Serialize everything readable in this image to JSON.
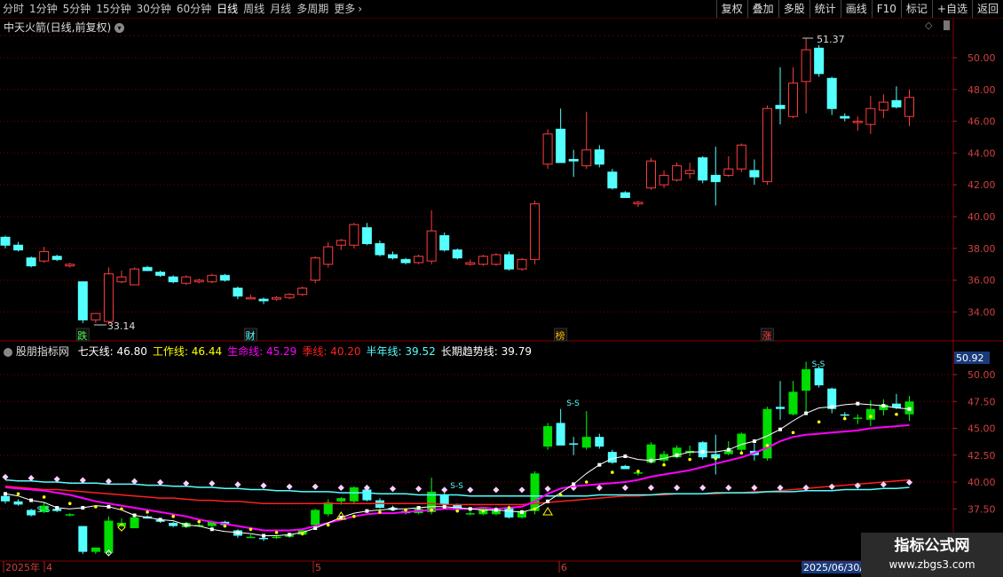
{
  "toolbar": {
    "periods": [
      "分时",
      "1分钟",
      "5分钟",
      "15分钟",
      "30分钟",
      "60分钟",
      "日线",
      "周线",
      "月线",
      "多周期",
      "更多"
    ],
    "active_period": "日线",
    "right_buttons": [
      "复权",
      "叠加",
      "多股",
      "统计",
      "画线",
      "F10",
      "标记",
      "+自选",
      "返回"
    ]
  },
  "colors": {
    "up": "#ff3c3c",
    "down": "#54ffff",
    "bg": "#000000",
    "grid": "#7a0000",
    "seven": "#ffffff",
    "work": "#ffff00",
    "life": "#ff00ff",
    "season": "#ff2020",
    "half": "#54ffff",
    "long": "#ffd0ff"
  },
  "main_panel": {
    "title": "中天火箭(日线,前复权)",
    "y_ticks": [
      "50.00",
      "48.00",
      "46.00",
      "44.00",
      "42.00",
      "40.00",
      "38.00",
      "36.00",
      "34.00"
    ],
    "high_label": "51.37",
    "low_label": "33.14",
    "event_tags": [
      "跌",
      "财",
      "榜",
      "涨"
    ]
  },
  "indicator_panel": {
    "title": "股朋指标网",
    "lines": [
      {
        "name": "七天线",
        "value": "46.80"
      },
      {
        "name": "工作线",
        "value": "46.44"
      },
      {
        "name": "生命线",
        "value": "45.29"
      },
      {
        "name": "季线",
        "value": "40.20"
      },
      {
        "name": "半年线",
        "value": "39.52"
      },
      {
        "name": "长期趋势线",
        "value": "39.79"
      }
    ],
    "current_value": "50.92",
    "y_ticks": [
      "50.00",
      "47.50",
      "45.00",
      "42.50",
      "40.00",
      "37.50"
    ],
    "signal_label": "S-S"
  },
  "x_axis": {
    "labels": [
      "2025年",
      "4",
      "5",
      "6"
    ],
    "cursor_date": "2025/06/30/"
  },
  "chart_data": {
    "type": "candlestick",
    "ylim": [
      33,
      52
    ],
    "ohlc": [
      [
        38.7,
        38.8,
        38.0,
        38.2
      ],
      [
        38.2,
        38.4,
        37.8,
        37.9
      ],
      [
        37.4,
        37.5,
        36.8,
        36.9
      ],
      [
        37.2,
        38.1,
        37.1,
        37.8
      ],
      [
        37.5,
        37.6,
        37.2,
        37.3
      ],
      [
        36.9,
        37.1,
        36.8,
        37.0
      ],
      [
        35.9,
        35.9,
        33.3,
        33.5
      ],
      [
        33.5,
        33.9,
        33.3,
        33.9
      ],
      [
        33.4,
        36.8,
        33.2,
        36.4
      ],
      [
        35.9,
        36.6,
        35.8,
        36.2
      ],
      [
        35.7,
        36.8,
        35.7,
        36.7
      ],
      [
        36.8,
        36.9,
        36.6,
        36.6
      ],
      [
        36.5,
        36.6,
        36.2,
        36.3
      ],
      [
        36.2,
        36.3,
        35.8,
        35.9
      ],
      [
        35.8,
        36.3,
        35.7,
        36.2
      ],
      [
        35.9,
        36.1,
        35.8,
        36.0
      ],
      [
        35.9,
        36.4,
        35.8,
        36.3
      ],
      [
        36.3,
        36.4,
        35.9,
        36.0
      ],
      [
        35.5,
        35.6,
        34.8,
        35.0
      ],
      [
        34.9,
        35.1,
        34.8,
        34.9
      ],
      [
        34.8,
        34.9,
        34.5,
        34.7
      ],
      [
        34.8,
        35.0,
        34.7,
        34.9
      ],
      [
        34.9,
        35.2,
        34.8,
        35.1
      ],
      [
        35.1,
        35.6,
        35.0,
        35.5
      ],
      [
        36.0,
        37.5,
        35.8,
        37.4
      ],
      [
        37.0,
        38.4,
        36.8,
        38.1
      ],
      [
        38.2,
        38.6,
        37.9,
        38.5
      ],
      [
        38.2,
        39.6,
        38.0,
        39.5
      ],
      [
        39.3,
        39.6,
        38.2,
        38.3
      ],
      [
        38.3,
        38.5,
        37.5,
        37.6
      ],
      [
        37.6,
        37.8,
        37.3,
        37.4
      ],
      [
        37.3,
        37.4,
        37.0,
        37.1
      ],
      [
        37.1,
        37.6,
        37.0,
        37.5
      ],
      [
        37.2,
        40.4,
        37.0,
        39.1
      ],
      [
        38.8,
        39.0,
        37.8,
        37.9
      ],
      [
        37.9,
        38.0,
        37.3,
        37.4
      ],
      [
        37.0,
        37.3,
        36.9,
        37.1
      ],
      [
        37.0,
        37.6,
        36.9,
        37.5
      ],
      [
        37.0,
        37.7,
        36.9,
        37.6
      ],
      [
        37.6,
        37.8,
        36.6,
        36.7
      ],
      [
        36.7,
        37.4,
        36.6,
        37.3
      ],
      [
        37.3,
        41.0,
        37.0,
        40.8
      ],
      [
        43.3,
        45.5,
        43.0,
        45.2
      ],
      [
        45.5,
        46.8,
        44.0,
        43.4
      ],
      [
        43.6,
        44.2,
        42.5,
        43.5
      ],
      [
        43.2,
        46.6,
        43.0,
        44.2
      ],
      [
        44.2,
        44.5,
        43.1,
        43.3
      ],
      [
        42.8,
        43.0,
        41.7,
        41.8
      ],
      [
        41.5,
        41.6,
        41.2,
        41.2
      ],
      [
        40.8,
        41.0,
        40.6,
        40.9
      ],
      [
        41.8,
        43.7,
        41.7,
        43.5
      ],
      [
        42.0,
        42.9,
        41.8,
        42.6
      ],
      [
        42.3,
        43.4,
        42.2,
        43.2
      ],
      [
        42.7,
        43.4,
        42.4,
        42.9
      ],
      [
        43.7,
        43.8,
        42.1,
        42.3
      ],
      [
        42.6,
        44.4,
        40.7,
        42.2
      ],
      [
        42.6,
        43.8,
        42.5,
        43.0
      ],
      [
        43.0,
        44.6,
        42.8,
        44.5
      ],
      [
        42.9,
        43.6,
        42.0,
        42.5
      ],
      [
        42.2,
        47.0,
        42.0,
        46.8
      ],
      [
        47.0,
        49.4,
        45.8,
        46.8
      ],
      [
        46.3,
        49.4,
        46.2,
        48.4
      ],
      [
        48.5,
        51.2,
        46.5,
        50.5
      ],
      [
        50.6,
        50.8,
        48.8,
        49.0
      ],
      [
        48.7,
        48.8,
        46.4,
        46.8
      ],
      [
        46.3,
        46.5,
        46.0,
        46.2
      ],
      [
        46.0,
        46.3,
        45.4,
        46.0
      ],
      [
        45.8,
        47.6,
        45.2,
        46.8
      ],
      [
        46.7,
        47.7,
        46.2,
        47.2
      ],
      [
        47.3,
        48.2,
        46.8,
        46.9
      ],
      [
        46.3,
        48.0,
        45.7,
        47.5
      ]
    ],
    "series": [
      {
        "name": "七天线",
        "values": [
          38.9,
          38.7,
          38.3,
          38.1,
          37.6,
          37.5,
          37.6,
          37.8,
          37.7,
          37.4,
          36.9,
          36.7,
          36.5,
          36.4,
          36.0,
          35.9,
          35.6,
          35.4,
          35.3,
          35.2,
          35.0,
          35.0,
          35.1,
          35.3,
          35.7,
          36.2,
          36.7,
          37.1,
          37.3,
          37.4,
          37.5,
          37.5,
          37.6,
          37.7,
          37.7,
          37.6,
          37.5,
          37.4,
          37.4,
          37.3,
          37.2,
          37.5,
          38.2,
          39.0,
          39.8,
          40.8,
          41.6,
          42.2,
          42.4,
          42.1,
          42.0,
          42.2,
          42.5,
          42.8,
          42.8,
          42.8,
          43.0,
          43.5,
          43.8,
          44.3,
          44.9,
          45.7,
          46.4,
          46.9,
          47.0,
          47.2,
          47.3,
          47.2,
          47.1,
          46.9,
          46.8
        ]
      },
      {
        "name": "工作线",
        "values": [
          39.3,
          38.9,
          38.7,
          38.6,
          38.4,
          38.0,
          37.9,
          37.7,
          37.5,
          37.5,
          37.5,
          37.2,
          37.0,
          36.8,
          36.5,
          36.3,
          36.1,
          35.9,
          35.8,
          35.6,
          35.4,
          35.3,
          35.1,
          35.2,
          35.6,
          36.0,
          36.4,
          36.8,
          37.0,
          37.2,
          37.3,
          37.4,
          37.3,
          37.4,
          37.4,
          37.3,
          37.2,
          37.3,
          37.4,
          37.6,
          37.5,
          37.5,
          38.2,
          38.8,
          39.5,
          40.0,
          40.5,
          40.9,
          41.2,
          41.0,
          41.4,
          41.6,
          41.8,
          42.1,
          42.3,
          42.2,
          42.5,
          42.7,
          43.0,
          43.4,
          44.0,
          44.6,
          45.2,
          45.6,
          45.8,
          45.9,
          45.9,
          46.1,
          46.2,
          46.3,
          46.4
        ]
      },
      {
        "name": "生命线",
        "values": [
          39.5,
          39.4,
          39.3,
          39.2,
          39.0,
          38.8,
          38.5,
          38.2,
          38.0,
          37.8,
          37.6,
          37.4,
          37.2,
          37.0,
          36.8,
          36.5,
          36.3,
          36.1,
          35.9,
          35.7,
          35.5,
          35.5,
          35.5,
          35.6,
          35.9,
          36.2,
          36.5,
          36.8,
          37.0,
          37.1,
          37.1,
          37.2,
          37.3,
          37.4,
          37.5,
          37.5,
          37.5,
          37.6,
          37.5,
          37.6,
          37.7,
          38.2,
          38.9,
          39.4,
          39.6,
          39.7,
          39.8,
          39.9,
          40.0,
          40.2,
          40.5,
          40.7,
          40.9,
          41.1,
          41.4,
          41.7,
          42.0,
          42.3,
          42.7,
          43.2,
          43.8,
          44.2,
          44.4,
          44.5,
          44.6,
          44.7,
          44.8,
          45.0,
          45.1,
          45.2,
          45.3
        ]
      },
      {
        "name": "季线",
        "values": [
          39.6,
          39.5,
          39.4,
          39.3,
          39.3,
          39.2,
          39.1,
          39.0,
          38.9,
          38.8,
          38.7,
          38.6,
          38.5,
          38.5,
          38.4,
          38.3,
          38.3,
          38.2,
          38.2,
          38.1,
          38.0,
          38.0,
          38.0,
          38.0,
          38.0,
          38.0,
          38.0,
          38.0,
          38.0,
          38.0,
          38.0,
          38.0,
          38.0,
          38.0,
          37.9,
          37.9,
          37.9,
          37.9,
          37.9,
          37.9,
          37.9,
          38.0,
          38.1,
          38.2,
          38.3,
          38.4,
          38.5,
          38.6,
          38.7,
          38.7,
          38.8,
          38.8,
          38.9,
          38.9,
          38.9,
          38.9,
          39.0,
          39.0,
          39.1,
          39.1,
          39.2,
          39.3,
          39.4,
          39.5,
          39.6,
          39.7,
          39.8,
          39.9,
          40.0,
          40.1,
          40.2
        ]
      },
      {
        "name": "半年线",
        "values": [
          40.2,
          40.1,
          40.1,
          40.0,
          40.0,
          39.9,
          39.9,
          39.9,
          39.8,
          39.8,
          39.8,
          39.7,
          39.7,
          39.6,
          39.6,
          39.5,
          39.5,
          39.4,
          39.4,
          39.3,
          39.3,
          39.2,
          39.2,
          39.1,
          39.1,
          39.1,
          39.0,
          39.0,
          39.0,
          38.9,
          38.9,
          38.9,
          38.8,
          38.8,
          38.8,
          38.8,
          38.7,
          38.7,
          38.7,
          38.7,
          38.7,
          38.7,
          38.7,
          38.7,
          38.7,
          38.7,
          38.8,
          38.8,
          38.8,
          38.8,
          38.8,
          38.9,
          38.9,
          38.9,
          38.9,
          39.0,
          39.0,
          39.0,
          39.0,
          39.1,
          39.1,
          39.1,
          39.2,
          39.2,
          39.2,
          39.3,
          39.3,
          39.3,
          39.4,
          39.4,
          39.5
        ]
      },
      {
        "name": "长期趋势线",
        "values": [
          40.3,
          40.2,
          40.2,
          40.1,
          40.1,
          40.0,
          40.0,
          40.0,
          39.9,
          39.9,
          39.9,
          39.8,
          39.8,
          39.8,
          39.7,
          39.7,
          39.7,
          39.6,
          39.6,
          39.5,
          39.5,
          39.5,
          39.4,
          39.4,
          39.4,
          39.3,
          39.3,
          39.3,
          39.3,
          39.2,
          39.2,
          39.2,
          39.2,
          39.2,
          39.1,
          39.1,
          39.1,
          39.1,
          39.1,
          39.1,
          39.1,
          39.1,
          39.2,
          39.2,
          39.3,
          39.3,
          39.3,
          39.3,
          39.3,
          39.3,
          39.3,
          39.3,
          39.3,
          39.3,
          39.3,
          39.3,
          39.3,
          39.3,
          39.3,
          39.3,
          39.3,
          39.3,
          39.3,
          39.4,
          39.4,
          39.4,
          39.5,
          39.5,
          39.6,
          39.7,
          39.8
        ]
      }
    ]
  }
}
